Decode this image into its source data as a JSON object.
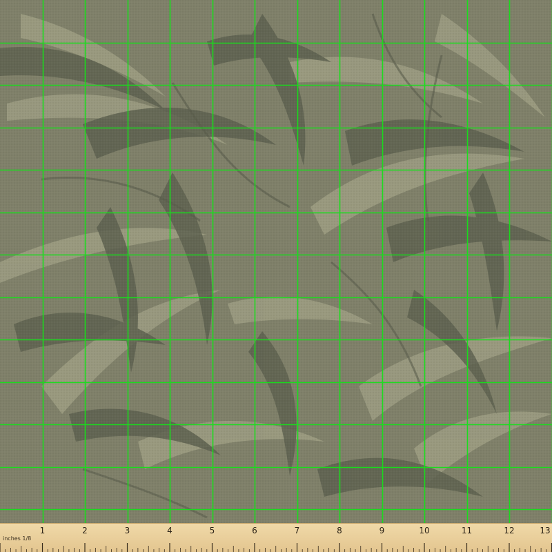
{
  "image": {
    "subject": "camo tropical palm leaf fabric swatch",
    "background_color": "#7f8069",
    "leaf_dark_color": "#5e6150",
    "leaf_light_color": "#a1a185",
    "grid_color": "#16e01a",
    "grid_spacing_inches": 1
  },
  "ruler": {
    "unit_label": "inches 1/8",
    "numbers": [
      "1",
      "2",
      "3",
      "4",
      "5",
      "6",
      "7",
      "8",
      "9",
      "10",
      "11",
      "12",
      "13"
    ],
    "color": "#ecd3a0"
  }
}
